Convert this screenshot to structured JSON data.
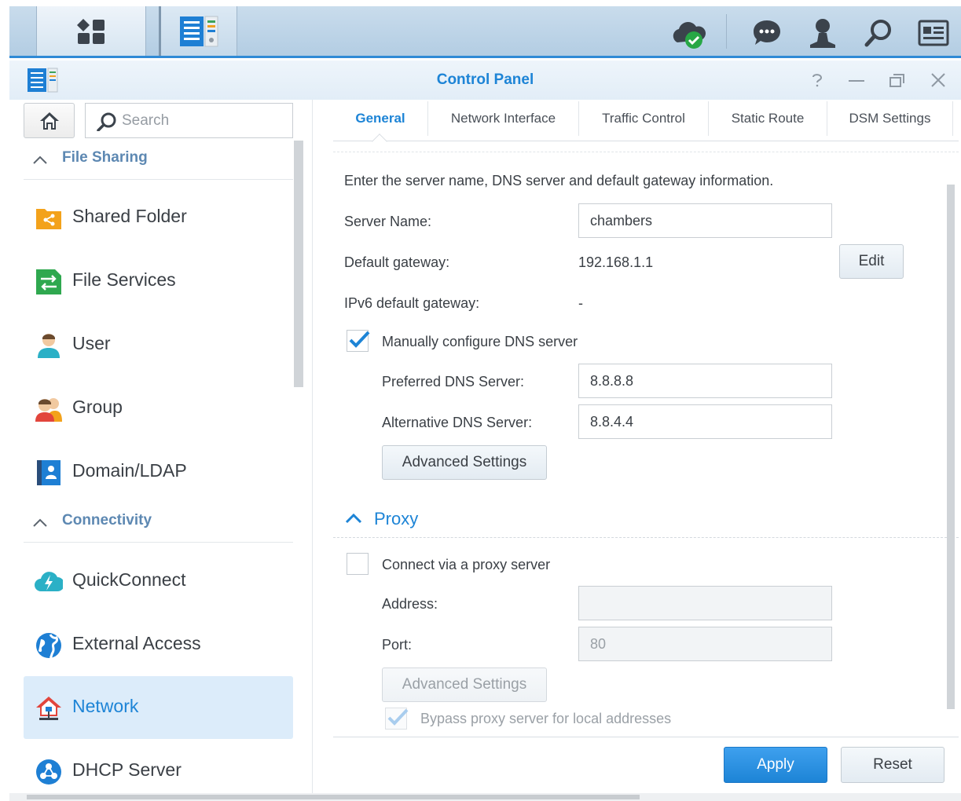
{
  "taskbar": {
    "main_menu_icon": "grid-icon",
    "control_panel_icon": "control-panel-icon",
    "right_icons": [
      "cloud-sync-icon",
      "chat-icon",
      "user-icon",
      "search-icon",
      "widgets-icon"
    ]
  },
  "window": {
    "title": "Control Panel",
    "controls": [
      "help-icon",
      "minimize-icon",
      "restore-icon",
      "close-icon"
    ]
  },
  "sidebar": {
    "search_placeholder": "Search",
    "sections": [
      {
        "label": "File Sharing"
      },
      {
        "label": "Connectivity"
      }
    ],
    "items": [
      {
        "label": "Shared Folder",
        "icon": "shared-folder-icon"
      },
      {
        "label": "File Services",
        "icon": "file-services-icon"
      },
      {
        "label": "User",
        "icon": "user-icon"
      },
      {
        "label": "Group",
        "icon": "group-icon"
      },
      {
        "label": "Domain/LDAP",
        "icon": "domain-ldap-icon"
      },
      {
        "label": "QuickConnect",
        "icon": "quickconnect-icon"
      },
      {
        "label": "External Access",
        "icon": "external-access-icon"
      },
      {
        "label": "Network",
        "icon": "network-icon",
        "active": true
      },
      {
        "label": "DHCP Server",
        "icon": "dhcp-server-icon"
      }
    ]
  },
  "tabs": [
    "General",
    "Network Interface",
    "Traffic Control",
    "Static Route",
    "DSM Settings"
  ],
  "general": {
    "intro": "Enter the server name, DNS server and default gateway information.",
    "server_name_label": "Server Name:",
    "server_name_value": "chambers",
    "default_gateway_label": "Default gateway:",
    "default_gateway_value": "192.168.1.1",
    "edit_label": "Edit",
    "ipv6_gateway_label": "IPv6 default gateway:",
    "ipv6_gateway_value": "-",
    "manual_dns_label": "Manually configure DNS server",
    "manual_dns_checked": true,
    "preferred_dns_label": "Preferred DNS Server:",
    "preferred_dns_value": "8.8.8.8",
    "alternative_dns_label": "Alternative DNS Server:",
    "alternative_dns_value": "8.8.4.4",
    "advanced_settings_label": "Advanced Settings"
  },
  "proxy": {
    "section_label": "Proxy",
    "connect_label": "Connect via a proxy server",
    "connect_checked": false,
    "address_label": "Address:",
    "address_value": "",
    "port_label": "Port:",
    "port_value": "80",
    "advanced_settings_label": "Advanced Settings",
    "bypass_label": "Bypass proxy server for local addresses",
    "bypass_checked": true
  },
  "footer": {
    "apply_label": "Apply",
    "reset_label": "Reset"
  },
  "colors": {
    "accent": "#1d84d6",
    "active_nav_bg": "#dcecfa",
    "section_header": "#5d88b2"
  }
}
